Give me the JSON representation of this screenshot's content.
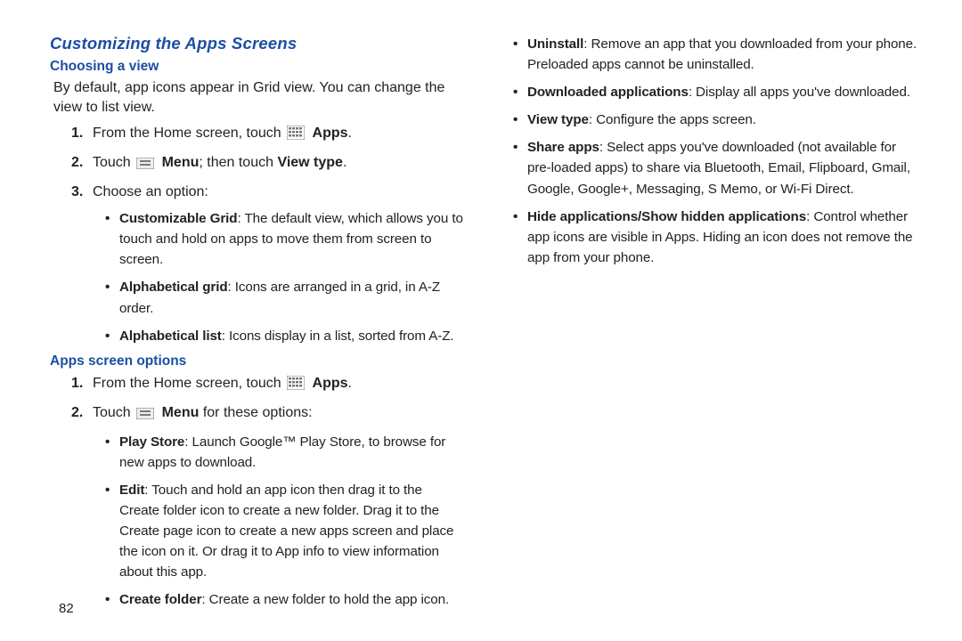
{
  "page_number": "82",
  "left": {
    "title": "Customizing the Apps Screens",
    "sec1_head": "Choosing a view",
    "sec1_para": "By default, app icons appear in Grid view. You can change the view to list view.",
    "step1_num": "1.",
    "step1_a": "From the Home screen, touch ",
    "step1_b": " Apps",
    "step1_c": ".",
    "step2_num": "2.",
    "step2_a": "Touch ",
    "step2_b": " Menu",
    "step2_c": "; then touch ",
    "step2_d": "View type",
    "step2_e": ".",
    "step3_num": "3.",
    "step3_a": "Choose an option:",
    "b1_t": "Customizable Grid",
    "b1_r": ": The default view, which allows you to touch and hold on apps to move them from screen to screen.",
    "b2_t": "Alphabetical grid",
    "b2_r": ": Icons are arranged in a grid, in A-Z order.",
    "b3_t": "Alphabetical list",
    "b3_r": ": Icons display in a list, sorted from A-Z.",
    "sec2_head": "Apps screen options",
    "s2step1_num": "1.",
    "s2step1_a": "From the Home screen, touch ",
    "s2step1_b": " Apps",
    "s2step1_c": ".",
    "s2step2_num": "2.",
    "s2step2_a": "Touch ",
    "s2step2_b": " Menu",
    "s2step2_c": " for these options:",
    "s2b1_t": "Play Store",
    "s2b1_r": ": Launch Google™ Play Store, to browse for new apps to download.",
    "s2b2_t": "Edit",
    "s2b2_r": ": Touch and hold an app icon then drag it to the Create folder icon to create a new folder. Drag it to the Create page icon to create a new apps screen and place the icon on it. Or drag it to App info to view information about this app.",
    "s2b3_t": "Create folder",
    "s2b3_r": ": Create a new folder to hold the app icon."
  },
  "right": {
    "r1_t": "Uninstall",
    "r1_r": ": Remove an app that you downloaded from your phone. Preloaded apps cannot be uninstalled.",
    "r2_t": "Downloaded applications",
    "r2_r": ": Display all apps you've downloaded.",
    "r3_t": "View type",
    "r3_r": ": Configure the apps screen.",
    "r4_t": "Share apps",
    "r4_r": ": Select apps you've downloaded (not available for pre-loaded apps) to share via Bluetooth, Email, Flipboard, Gmail, Google, Google+, Messaging, S Memo, or Wi-Fi Direct.",
    "r5_t": "Hide applications/Show hidden applications",
    "r5_r": ": Control whether app icons are visible in Apps. Hiding an icon does not remove the app from your phone."
  }
}
